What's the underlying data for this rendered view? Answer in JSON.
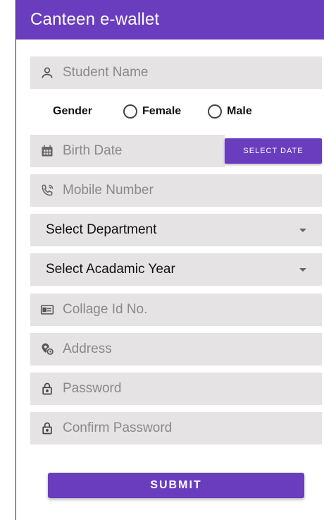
{
  "app": {
    "title": "Canteen e-wallet"
  },
  "colors": {
    "primary": "#6a3dbf",
    "field_bg": "#e5e3e3"
  },
  "form": {
    "student_name": {
      "placeholder": "Student Name",
      "icon": "person-icon"
    },
    "gender": {
      "label": "Gender",
      "options": [
        "Female",
        "Male"
      ]
    },
    "birth_date": {
      "placeholder": "Birth Date",
      "icon": "calendar-icon",
      "button_label": "SELECT DATE"
    },
    "mobile": {
      "placeholder": "Mobile Number",
      "icon": "phone-icon"
    },
    "department": {
      "selected": "Select Department"
    },
    "academic_year": {
      "selected": "Select Acadamic Year"
    },
    "college_id": {
      "placeholder": "Collage Id No.",
      "icon": "id-card-icon"
    },
    "address": {
      "placeholder": "Address",
      "icon": "location-icon"
    },
    "password": {
      "placeholder": "Password",
      "icon": "lock-icon"
    },
    "confirm_password": {
      "placeholder": "Confirm Password",
      "icon": "lock-icon"
    },
    "submit_label": "SUBMIT"
  }
}
